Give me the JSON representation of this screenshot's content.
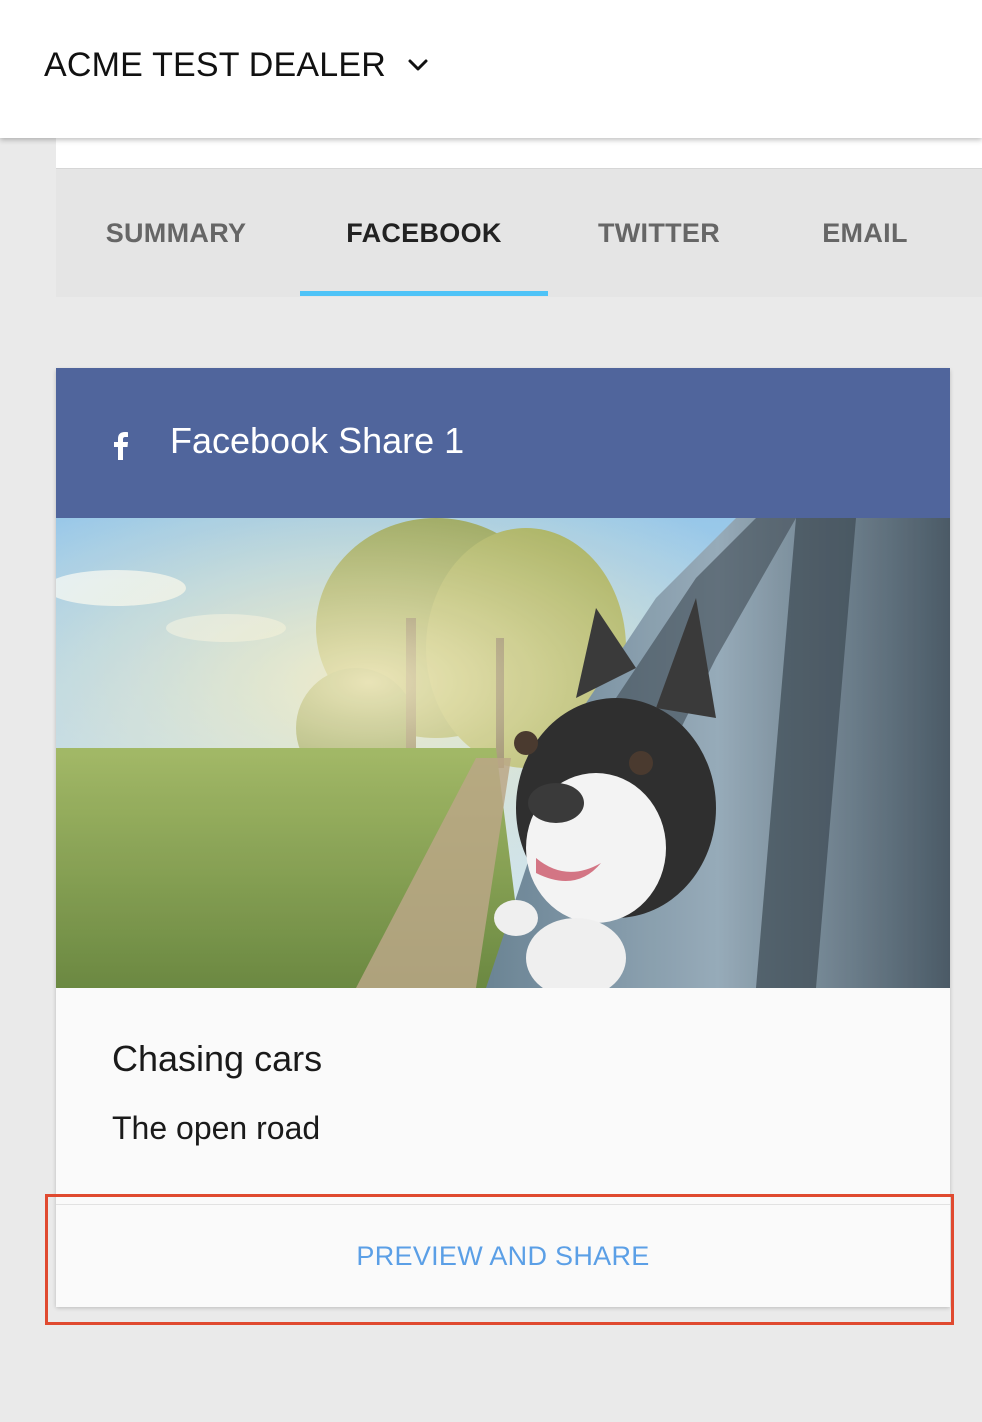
{
  "header": {
    "dealer_name": "ACME TEST DEALER",
    "dropdown_icon": "chevron-down-icon"
  },
  "tabs": [
    {
      "label": "SUMMARY",
      "active": false
    },
    {
      "label": "FACEBOOK",
      "active": true
    },
    {
      "label": "TWITTER",
      "active": false
    },
    {
      "label": "EMAIL",
      "active": false
    }
  ],
  "card": {
    "icon": "facebook-icon",
    "title": "Facebook Share 1",
    "image_description": "dog-in-car-window-photo",
    "post_title": "Chasing cars",
    "post_text": "The open road",
    "action_label": "PREVIEW AND SHARE"
  },
  "colors": {
    "facebook_header": "#50659c",
    "tab_indicator": "#4fc3f7",
    "action_link": "#5b9fe6",
    "highlight": "#e04a30"
  }
}
